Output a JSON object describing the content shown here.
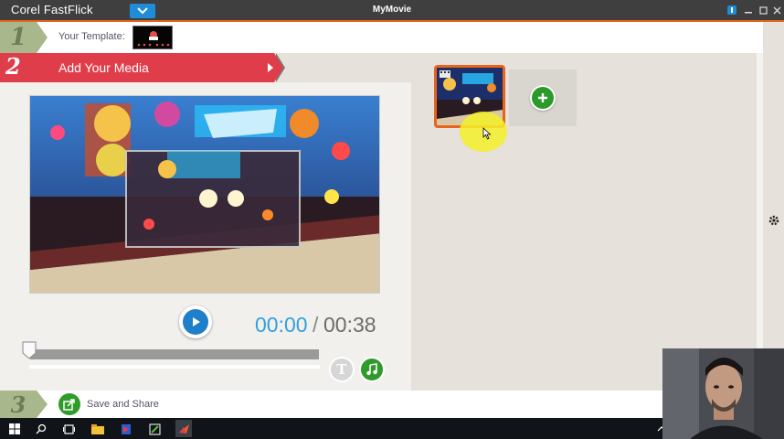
{
  "window": {
    "app_name": "Corel FastFlick",
    "title": "MyMovie"
  },
  "step1": {
    "number": "1",
    "label": "Your Template:"
  },
  "step2": {
    "number": "2",
    "label": "Add Your Media"
  },
  "player": {
    "current_time": "00:00",
    "separator": "/",
    "total_time": "00:38",
    "progress": 0
  },
  "step3": {
    "number": "3",
    "label": "Save and Share"
  },
  "colors": {
    "accent_orange": "#e8641b",
    "step2_red": "#e03d4b",
    "step_green": "#a8b78c",
    "play_blue": "#1f7fc8",
    "time_blue": "#33a0dc",
    "action_green": "#2f9b2a"
  },
  "icons": {
    "dropdown": "chevron-down-icon",
    "play": "play-icon",
    "title": "title-icon",
    "music": "music-note-icon",
    "add": "plus-icon",
    "share": "share-icon",
    "settings": "gear-icon"
  }
}
